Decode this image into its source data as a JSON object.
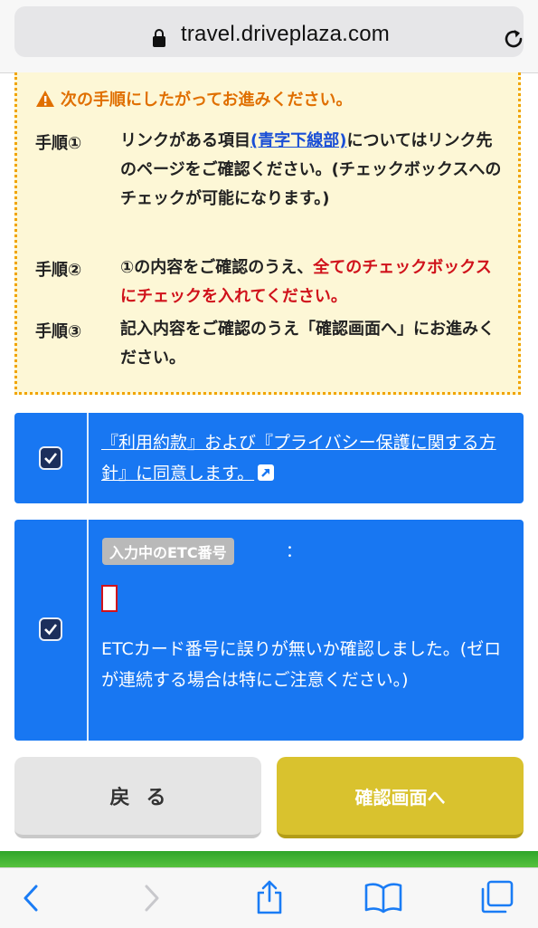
{
  "browser": {
    "url": "travel.driveplaza.com"
  },
  "notice": {
    "heading": "次の手順にしたがってお進みください。",
    "steps": [
      {
        "label": "手順①",
        "text_a": "リンクがある項目",
        "link": "(青字下線部)",
        "text_b": "についてはリンク先のページをご確認ください。(チェックボックスへのチェックが可能になります。)"
      },
      {
        "label": "手順②",
        "text_a": "①の内容をご確認のうえ、",
        "emphasis": "全てのチェックボックスにチェックを入れてください。"
      },
      {
        "label": "手順③",
        "text_a": "記入内容をご確認のうえ「確認画面へ」にお進みください。"
      }
    ]
  },
  "agreement": {
    "terms_link": "『利用約款』および『プライバシー保護に関する方針』に同意します。",
    "checked": true
  },
  "etc": {
    "badge": "入力中のETC番号",
    "colon": "：",
    "value": "",
    "confirm_text": "ETCカード番号に誤りが無いか確認しました。(ゼロが連続する場合は特にご注意ください。)",
    "checked": true
  },
  "buttons": {
    "back": "戻る",
    "confirm": "確認画面へ"
  },
  "colors": {
    "panel_blue": "#1877f2",
    "notice_bg": "#fdf7d6",
    "notice_border": "#f1a400",
    "warning_orange": "#e06f00",
    "emphasis_red": "#d0121b",
    "confirm_yellow": "#d9c22e"
  }
}
